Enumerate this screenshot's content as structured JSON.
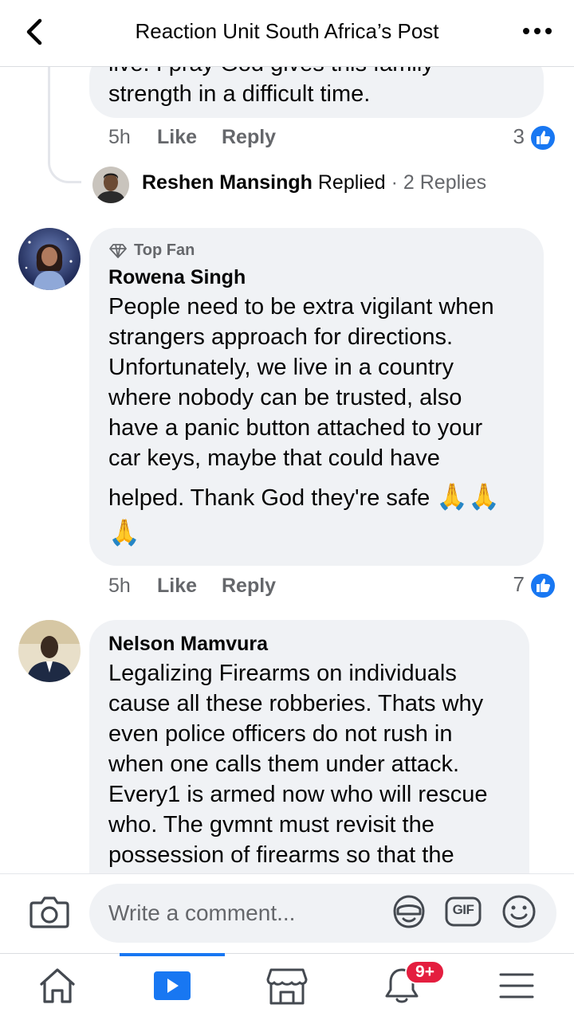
{
  "header": {
    "title": "Reaction Unit South Africa’s Post",
    "back_icon": "chevron-left-icon",
    "more_icon": "more-horizontal-icon"
  },
  "comments": [
    {
      "text_lines": [
        "live. I pray God gives this family",
        "strength in a difficult time."
      ],
      "time": "5h",
      "like_label": "Like",
      "reply_label": "Reply",
      "reaction_count": "3"
    },
    {
      "badge": "Top Fan",
      "name": "Rowena Singh",
      "text_lines": [
        "People need to be extra vigilant when",
        "strangers approach for directions.",
        "Unfortunately, we live in a country",
        "where nobody can be trusted, also",
        "have a panic button attached to your",
        "car keys, maybe that could have",
        "helped. Thank God they're safe"
      ],
      "emoji": "🙏",
      "time": "5h",
      "like_label": "Like",
      "reply_label": "Reply",
      "reaction_count": "7"
    },
    {
      "name": "Nelson Mamvura",
      "text_lines": [
        "Legalizing Firearms on individuals",
        "cause all these robberies. Thats why",
        "even police officers do not rush in",
        "when one calls them under attack.",
        "Every1 is armed now who will rescue",
        "who. The gvmnt must revisit the",
        "possession of firearms so that the"
      ]
    }
  ],
  "reply_summary": {
    "name": "Reshen Mansingh",
    "action": "Replied",
    "separator": "·",
    "count_text": "2 Replies"
  },
  "composer": {
    "placeholder": "Write a comment...",
    "gif_label": "GIF"
  },
  "tabbar": {
    "notification_badge": "9+",
    "active_tab": "watch"
  },
  "colors": {
    "accent": "#1877f2",
    "bubble": "#f0f2f5",
    "secondary_text": "#65676b",
    "badge": "#e41e3f"
  }
}
